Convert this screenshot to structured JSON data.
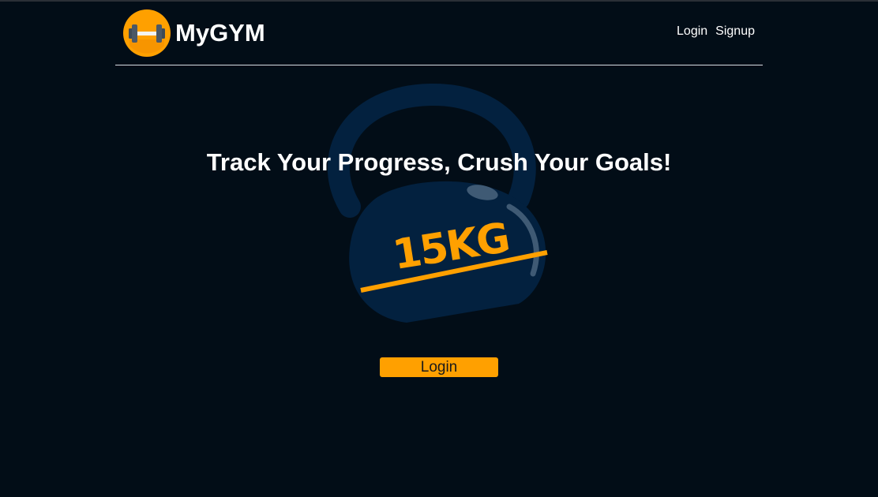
{
  "header": {
    "brand_name": "MyGYM",
    "logo_icon": "dumbbell-icon",
    "nav": {
      "login_label": "Login",
      "signup_label": "Signup"
    }
  },
  "hero": {
    "title": "Track Your Progress, Crush Your Goals!",
    "kettlebell_label": "15KG",
    "kettlebell_icon": "kettlebell-icon",
    "cta_label": "Login"
  },
  "colors": {
    "background": "#020d17",
    "accent": "#ffa000",
    "kettlebell": "#03213f",
    "text": "#ffffff"
  }
}
